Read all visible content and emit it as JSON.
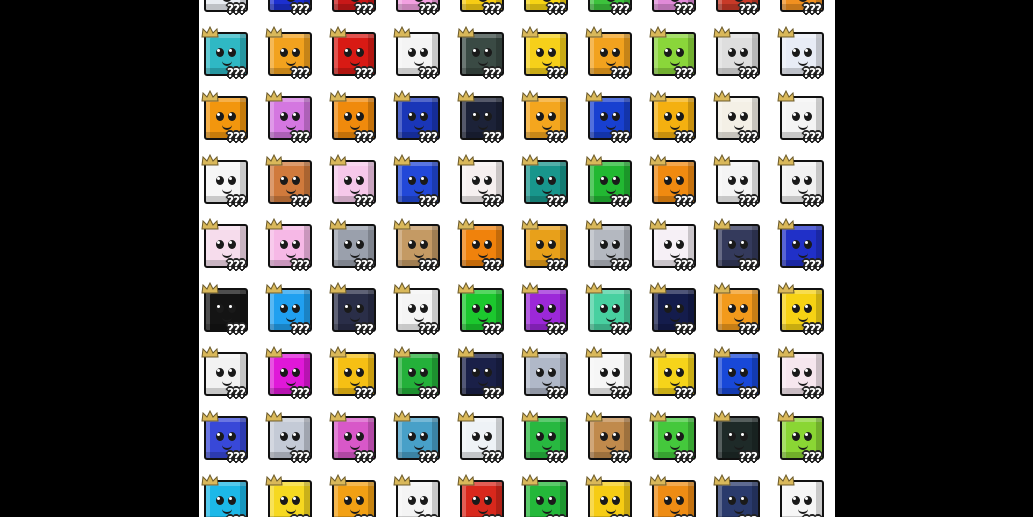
{
  "grid": {
    "lock_label": "???",
    "rows": [
      [
        "#e8ecf2",
        "#1c2fd0",
        "#c81818",
        "#f2a0e0",
        "#f6cc14",
        "#f6d414",
        "#3cc23c",
        "#e08ad8",
        "#c83a28",
        "#f09020"
      ],
      [
        "#2fb8c4",
        "#f2a21e",
        "#d81a14",
        "#f4f4f4",
        "#3a4a44",
        "#f6d01a",
        "#f2a21e",
        "#8ad63a",
        "#dedede",
        "#e8ecf6"
      ],
      [
        "#f2960e",
        "#d477e0",
        "#f08a0c",
        "#1a36b8",
        "#1c2238",
        "#f4a61e",
        "#1840d0",
        "#f4b010",
        "#f4f0e6",
        "#f4f4f4"
      ],
      [
        "#f6f6f6",
        "#d07a3c",
        "#f6c8ea",
        "#2248d8",
        "#f6f0f0",
        "#18968c",
        "#22b832",
        "#f08a10",
        "#f4f4f4",
        "#f2f2f2"
      ],
      [
        "#f6dcec",
        "#f6b8e6",
        "#9aa0ac",
        "#c49a64",
        "#f0820c",
        "#e8a01a",
        "#b4b8c0",
        "#f6f0f6",
        "#343a5c",
        "#2030c8"
      ],
      [
        "#141414",
        "#20a0f0",
        "#2a2e48",
        "#f4f4f4",
        "#1cc82e",
        "#9c28d8",
        "#48d0a0",
        "#141c4c",
        "#f29a1c",
        "#f6d214"
      ],
      [
        "#f2f2f2",
        "#e018d8",
        "#f6c014",
        "#24b03a",
        "#1a2048",
        "#b0b8c8",
        "#f6f6f6",
        "#f6d41a",
        "#1848d8",
        "#f6e6ee"
      ],
      [
        "#3848d8",
        "#c4cad6",
        "#d858c8",
        "#48a0c8",
        "#eef2f6",
        "#28b840",
        "#c08a4c",
        "#44c83c",
        "#1e2a28",
        "#8ad634"
      ],
      [
        "#1cb8e8",
        "#f6d820",
        "#f2a014",
        "#f4f4f4",
        "#d8281c",
        "#24b83a",
        "#f6cc14",
        "#ee8c14",
        "#2a3a6c",
        "#f6f6f6"
      ]
    ]
  }
}
